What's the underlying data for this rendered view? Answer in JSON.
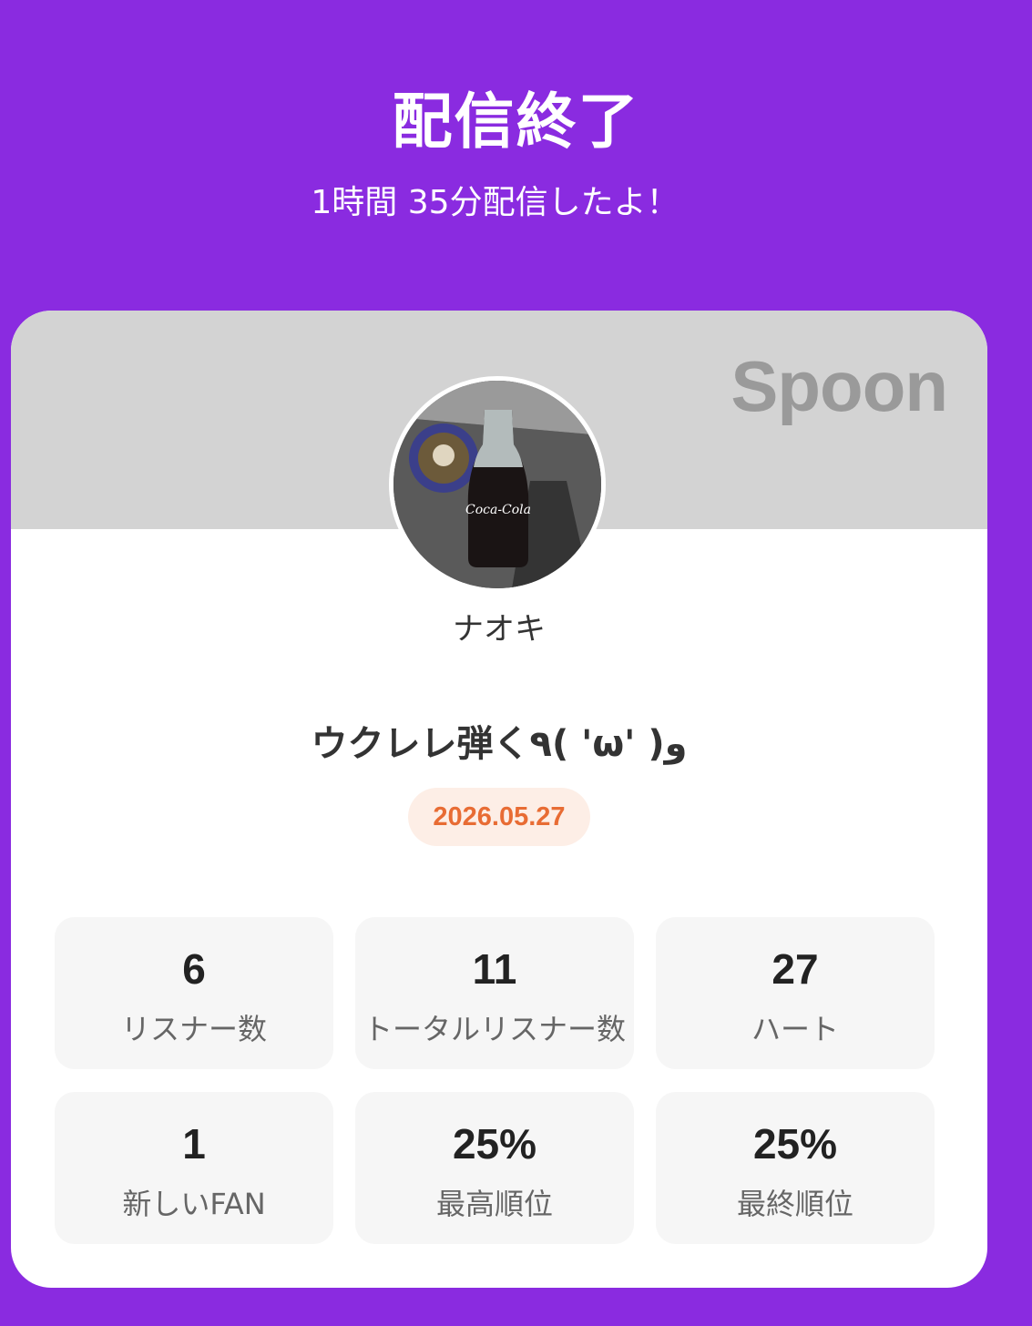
{
  "header": {
    "title": "配信終了",
    "subtitle": "1時間 35分配信したよ！"
  },
  "card": {
    "brand": "Spoon",
    "avatar_icon": "profile-photo-cola-bottle",
    "username": "ナオキ",
    "broadcast_title": "ウクレレ弾く٩( 'ω' )و",
    "date": "2026.05.27",
    "colors": {
      "background": "#8a2be0",
      "banner": "#d3d3d3",
      "date_text": "#e86c34",
      "date_bg": "#fdeee6"
    }
  },
  "stats": [
    {
      "value": "6",
      "label": "リスナー数"
    },
    {
      "value": "11",
      "label": "トータルリスナー数"
    },
    {
      "value": "27",
      "label": "ハート"
    },
    {
      "value": "1",
      "label": "新しいFAN"
    },
    {
      "value": "25%",
      "label": "最高順位"
    },
    {
      "value": "25%",
      "label": "最終順位"
    }
  ]
}
